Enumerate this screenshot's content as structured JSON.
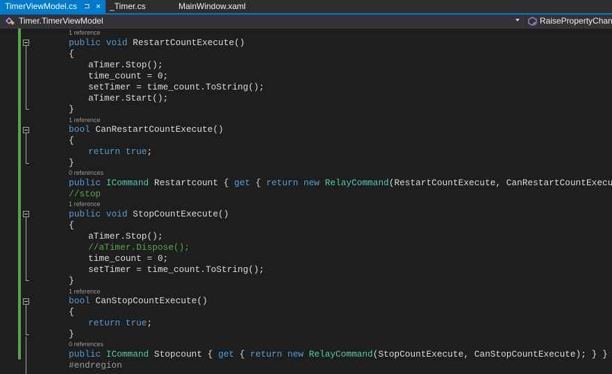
{
  "tabs": [
    {
      "label": "TimerViewModel.cs",
      "active": true,
      "pin": "⊐",
      "close": "×"
    },
    {
      "label": "_Timer.cs",
      "active": false
    },
    {
      "label": "MainWindow.xaml",
      "active": false
    }
  ],
  "navbar": {
    "class_icon": "class-icon",
    "class_label": "Timer.TimerViewModel",
    "member_icon": "method-icon",
    "member_label": "RaisePropertyChanged"
  },
  "colors": {
    "accent": "#007acc",
    "keyword": "#569cd6",
    "type": "#4ec9b0",
    "comment": "#57a64a",
    "text": "#dcdcdc",
    "codelens": "#999999",
    "change_bar": "#57a64a"
  },
  "code": {
    "lens": [
      "1 reference",
      "1 reference",
      "0 references",
      "1 reference",
      "1 reference",
      "0 references"
    ],
    "lines": [
      {
        "kind": "code",
        "tokens": [
          [
            "kw",
            "public"
          ],
          [
            "",
            ""
          ],
          [
            "kw",
            "void"
          ],
          [
            "",
            "RestartCountExecute()"
          ]
        ]
      },
      {
        "kind": "code",
        "text": "{"
      },
      {
        "kind": "code",
        "text": "aTimer.Stop();"
      },
      {
        "kind": "code",
        "text": "time_count = 0;"
      },
      {
        "kind": "code",
        "text": "setTimer = time_count.ToString();"
      },
      {
        "kind": "code",
        "text": "aTimer.Start();"
      },
      {
        "kind": "code",
        "text": "}"
      }
    ],
    "m1_sig": [
      "public",
      "void",
      "RestartCountExecute()"
    ],
    "m1_body": [
      "{",
      "aTimer.Stop();",
      "time_count = 0;",
      "setTimer = time_count.ToString();",
      "aTimer.Start();",
      "}"
    ],
    "m2_sig": [
      "bool",
      "CanRestartCountExecute()"
    ],
    "m2_body": [
      "{",
      "return",
      "true",
      ";",
      "}"
    ],
    "p1": [
      "public",
      "ICommand",
      "Restartcount { ",
      "get",
      " { ",
      "return",
      "new",
      "RelayCommand",
      "(RestartCountExecute, CanRestartCountExecute); } }"
    ],
    "c1": "//stop",
    "m3_sig": [
      "public",
      "void",
      "StopCountExecute()"
    ],
    "m3_body": [
      "{",
      "aTimer.Stop();",
      "//aTimer.Dispose();",
      "time_count = 0;",
      "setTimer = time_count.ToString();",
      "}"
    ],
    "m4_sig": [
      "bool",
      "CanStopCountExecute()"
    ],
    "m4_body": [
      "{",
      "return",
      "true",
      ";",
      "}"
    ],
    "p2": [
      "public",
      "ICommand",
      "Stopcount { ",
      "get",
      " { ",
      "return",
      "new",
      "RelayCommand",
      "(StopCountExecute, CanStopCountExecute); } }"
    ],
    "endregion": "#endregion"
  }
}
